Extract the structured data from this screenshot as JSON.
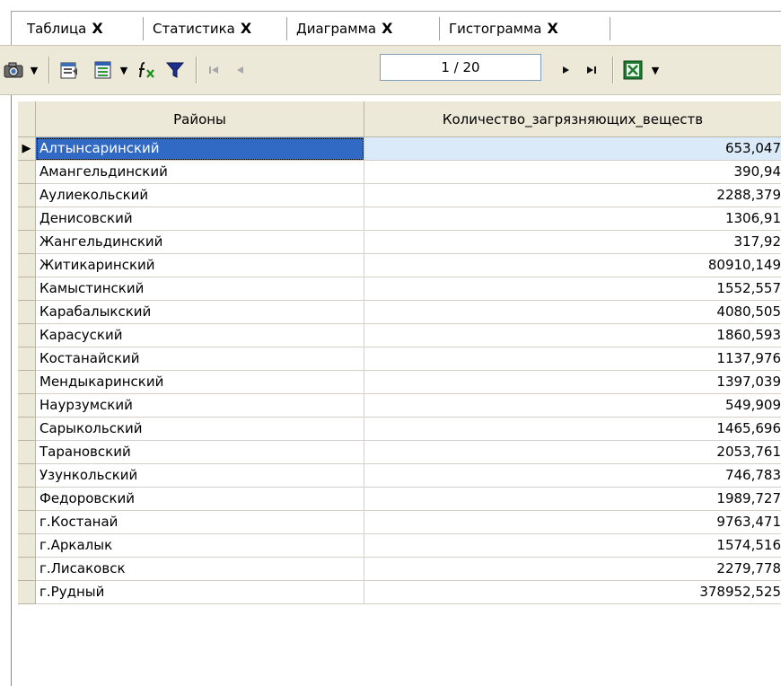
{
  "tabs": [
    {
      "label": "Таблица",
      "close": "X"
    },
    {
      "label": "Статистика",
      "close": "X"
    },
    {
      "label": "Диаграмма",
      "close": "X"
    },
    {
      "label": "Гистограмма",
      "close": "X"
    }
  ],
  "toolbar": {
    "pager": "1 / 20"
  },
  "table": {
    "columns": [
      "Районы",
      "Количество_загрязняющих_веществ"
    ],
    "current_row_marker": "▶",
    "rows": [
      [
        "Алтынсаринский",
        "653,047"
      ],
      [
        "Амангельдинский",
        "390,94"
      ],
      [
        "Аулиекольский",
        "2288,379"
      ],
      [
        "Денисовский",
        "1306,91"
      ],
      [
        "Жангельдинский",
        "317,92"
      ],
      [
        "Житикаринский",
        "80910,149"
      ],
      [
        "Камыстинский",
        "1552,557"
      ],
      [
        "Карабалыкский",
        "4080,505"
      ],
      [
        "Карасуский",
        "1860,593"
      ],
      [
        "Костанайский",
        "1137,976"
      ],
      [
        "Мендыкаринский",
        "1397,039"
      ],
      [
        "Наурзумский",
        "549,909"
      ],
      [
        "Сарыкольский",
        "1465,696"
      ],
      [
        "Тарановский",
        "2053,761"
      ],
      [
        "Узункольский",
        "746,783"
      ],
      [
        "Федоровский",
        "1989,727"
      ],
      [
        "г.Костанай",
        "9763,471"
      ],
      [
        "г.Аркалык",
        "1574,516"
      ],
      [
        "г.Лисаковск",
        "2279,778"
      ],
      [
        "г.Рудный",
        "378952,525"
      ]
    ]
  }
}
